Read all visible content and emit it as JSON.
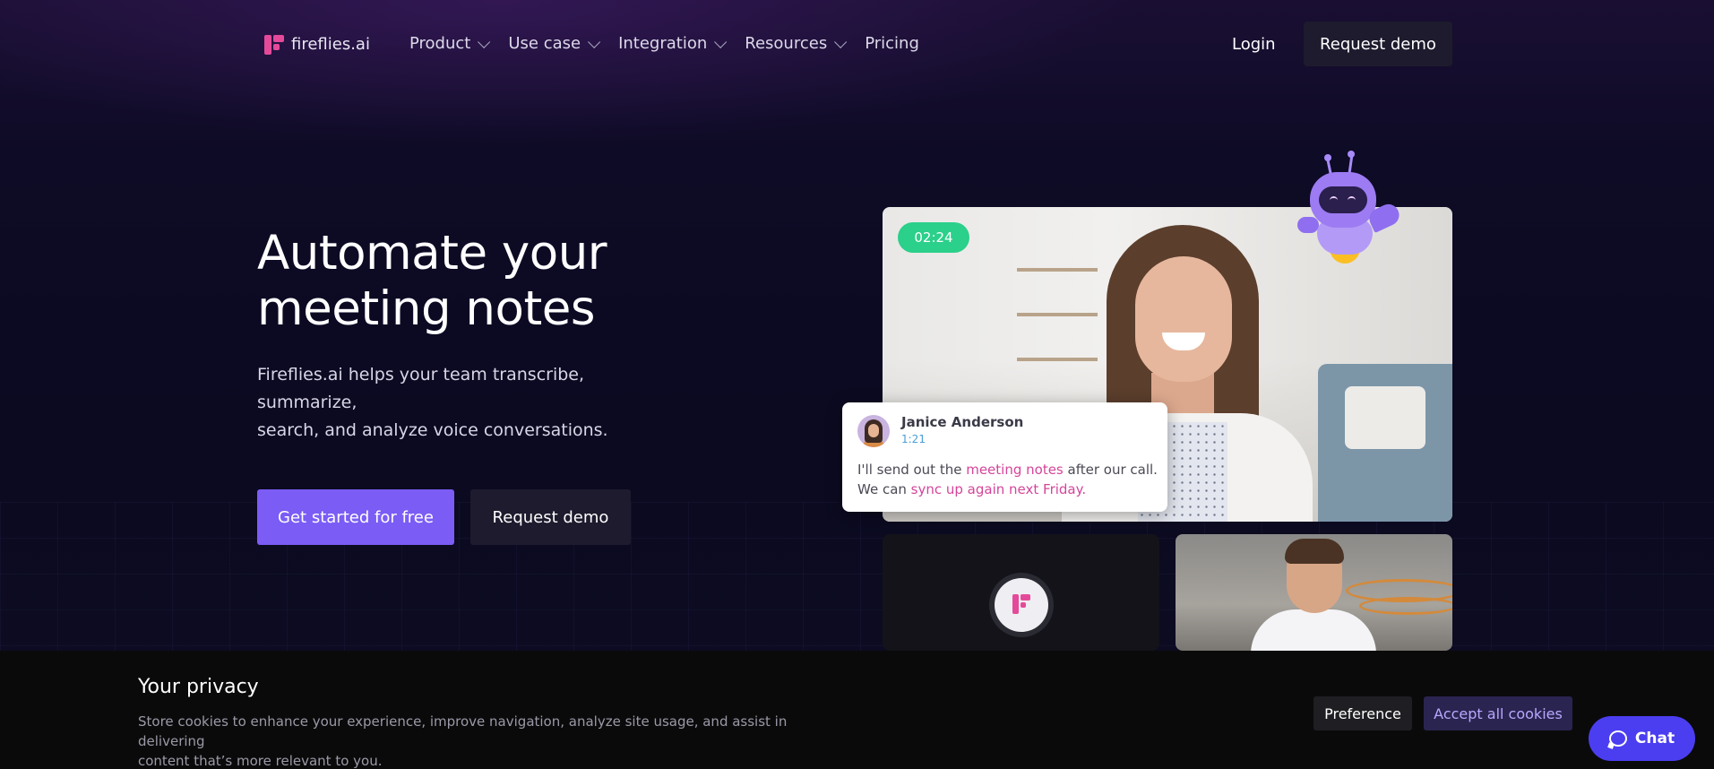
{
  "nav": {
    "logo_text": "fireflies.ai",
    "items": [
      {
        "label": "Product",
        "has_dropdown": true
      },
      {
        "label": "Use case",
        "has_dropdown": true
      },
      {
        "label": "Integration",
        "has_dropdown": true
      },
      {
        "label": "Resources",
        "has_dropdown": true
      },
      {
        "label": "Pricing",
        "has_dropdown": false
      }
    ],
    "login": "Login",
    "request_demo": "Request demo"
  },
  "hero": {
    "title_line1": "Automate your",
    "title_line2": "meeting notes",
    "subtitle_line1": "Fireflies.ai helps your team transcribe, summarize,",
    "subtitle_line2": "search, and analyze voice conversations.",
    "cta_primary": "Get started for free",
    "cta_secondary": "Request demo"
  },
  "video": {
    "timer": "02:24",
    "caption": {
      "name": "Janice Anderson",
      "time": "1:21",
      "text_1": "I'll send out the ",
      "highlight_1": "meeting notes",
      "text_2": " after our call.",
      "text_3": "We can ",
      "highlight_2": "sync up again next Friday."
    }
  },
  "cookie": {
    "title": "Your privacy",
    "text_line1": "Store cookies to enhance your experience, improve navigation, analyze site usage, and assist in delivering",
    "text_line2": "content that’s more relevant to you.",
    "preference": "Preference",
    "accept": "Accept all cookies"
  },
  "chat": {
    "label": "Chat"
  },
  "colors": {
    "accent": "#7b5cf5",
    "brand_pink": "#e54a9a",
    "timer_green": "#2bd08a",
    "chat_blue": "#4b3ef0"
  },
  "icons": [
    "fireflies-logo-icon",
    "chevron-down-icon",
    "robot-mascot-icon",
    "chat-bubble-icon"
  ]
}
